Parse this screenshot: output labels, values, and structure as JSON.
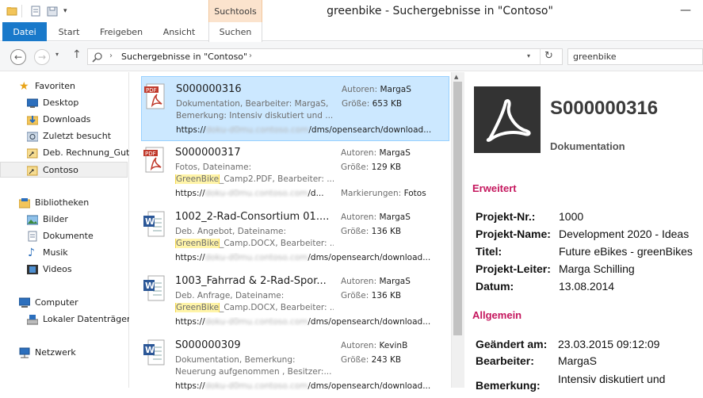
{
  "window": {
    "title": "greenbike - Suchergebnisse in \"Contoso\"",
    "context_tab": "Suchtools",
    "controls": [
      "minimize",
      "maximize",
      "close"
    ]
  },
  "ribbon": {
    "tabs": [
      {
        "label": "Datei",
        "active": false
      },
      {
        "label": "Start",
        "active": false
      },
      {
        "label": "Freigeben",
        "active": false
      },
      {
        "label": "Ansicht",
        "active": false
      },
      {
        "label": "Suchen",
        "active": true
      }
    ]
  },
  "address": {
    "path": "Suchergebnisse in \"Contoso\"",
    "search_value": "greenbike"
  },
  "nav": {
    "favorites_header": "Favoriten",
    "favorites": [
      "Desktop",
      "Downloads",
      "Zuletzt besucht",
      "Deb. Rechnung_Gut",
      "Contoso"
    ],
    "libraries_header": "Bibliotheken",
    "libraries": [
      "Bilder",
      "Dokumente",
      "Musik",
      "Videos"
    ],
    "computer_header": "Computer",
    "computer": [
      "Lokaler Datenträger"
    ],
    "network_header": "Netzwerk"
  },
  "results": [
    {
      "type": "pdf",
      "title": "S000000316",
      "line1": "Dokumentation, Bearbeiter: MargaS,",
      "line2": "Bemerkung: Intensiv diskutiert und ...",
      "url_prefix": "https://",
      "url_blur": "doku-d0mu.contoso.com",
      "url_suffix": "/dms/opensearch/download...",
      "author_label": "Autoren:",
      "author": "MargaS",
      "size_label": "Größe:",
      "size": "653 KB"
    },
    {
      "type": "pdf",
      "title": "S000000317",
      "line1": "Fotos, Dateiname:",
      "line2_hl": "GreenBike",
      "line2": "_Camp2.PDF, Bearbeiter: ...",
      "url_prefix": "https://",
      "url_blur": "doku-d0mu.contoso.com",
      "url_suffix": "/d...",
      "author_label": "Autoren:",
      "author": "MargaS",
      "size_label": "Größe:",
      "size": "129 KB",
      "tags_label": "Markierungen:",
      "tags": "Fotos"
    },
    {
      "type": "word",
      "title": "1002_2-Rad-Consortium 01....",
      "line1": "Deb. Angebot, Dateiname:",
      "line2_hl": "GreenBike",
      "line2": "_Camp.DOCX, Bearbeiter: ...",
      "url_prefix": "https://",
      "url_blur": "doku-d0mu.contoso.com",
      "url_suffix": "/dms/opensearch/download...",
      "author_label": "Autoren:",
      "author": "MargaS",
      "size_label": "Größe:",
      "size": "136 KB"
    },
    {
      "type": "word",
      "title": "1003_Fahrrad & 2-Rad-Spor...",
      "line1": "Deb. Anfrage, Dateiname:",
      "line2_hl": "GreenBike",
      "line2": "_Camp.DOCX, Bearbeiter: ...",
      "url_prefix": "https://",
      "url_blur": "doku-d0mu.contoso.com",
      "url_suffix": "/dms/opensearch/download...",
      "author_label": "Autoren:",
      "author": "MargaS",
      "size_label": "Größe:",
      "size": "136 KB"
    },
    {
      "type": "word",
      "title": "S000000309",
      "line1": "Dokumentation, Bemerkung:",
      "line2": "Neuerung aufgenommen , Besitzer:...",
      "url_prefix": "https://",
      "url_blur": "doku-d0mu.contoso.com",
      "url_suffix": "/dms/opensearch/download...",
      "author_label": "Autoren:",
      "author": "KevinB",
      "size_label": "Größe:",
      "size": "243 KB"
    }
  ],
  "preview": {
    "title": "S000000316",
    "subtitle": "Dokumentation",
    "section_extended": "Erweitert",
    "extended": [
      {
        "key": "Projekt-Nr.:",
        "value": "1000"
      },
      {
        "key": "Projekt-Name:",
        "value": "Development 2020 - Ideas"
      },
      {
        "key": "Titel:",
        "value": "Future eBikes - greenBikes"
      },
      {
        "key": "Projekt-Leiter:",
        "value": "Marga Schilling"
      },
      {
        "key": "Datum:",
        "value": "13.08.2014"
      }
    ],
    "section_general": "Allgemein",
    "general": [
      {
        "key": "Geändert am:",
        "value": "23.03.2015 09:12:09"
      },
      {
        "key": "Bearbeiter:",
        "value": "MargaS"
      },
      {
        "key": "Bemerkung:",
        "value": "Intensiv diskutiert und"
      }
    ]
  },
  "colors": {
    "accent": "#1979ca",
    "selection": "#cce8ff",
    "section_heading": "#c5175e",
    "highlight": "#fff4a8",
    "context_tab": "#fbe3cd"
  }
}
